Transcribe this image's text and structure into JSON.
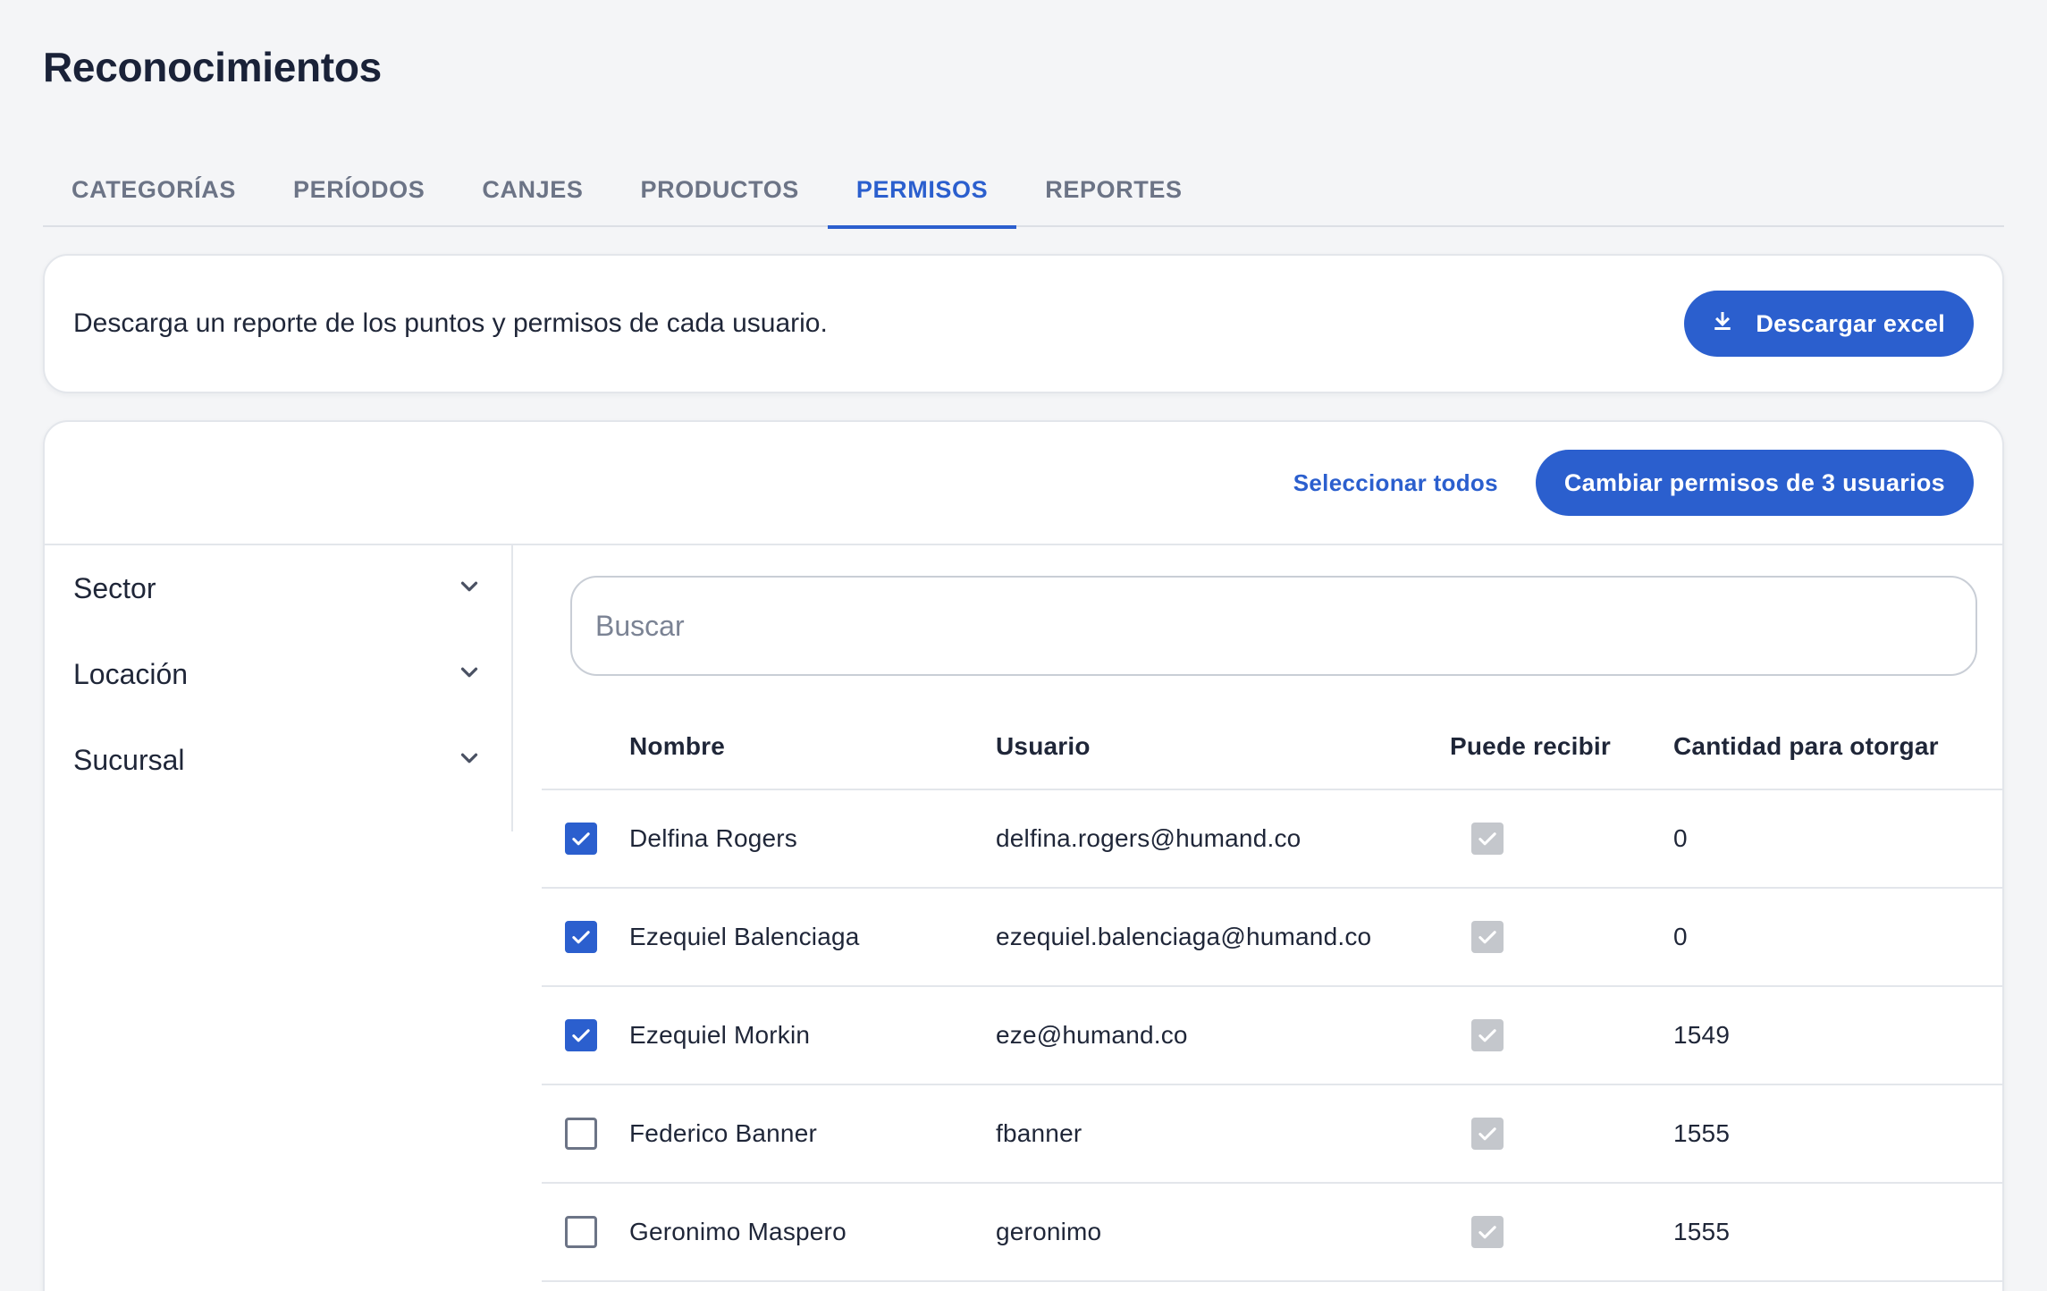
{
  "page": {
    "title": "Reconocimientos"
  },
  "tabs": [
    {
      "label": "CATEGORÍAS",
      "active": false
    },
    {
      "label": "PERÍODOS",
      "active": false
    },
    {
      "label": "CANJES",
      "active": false
    },
    {
      "label": "PRODUCTOS",
      "active": false
    },
    {
      "label": "PERMISOS",
      "active": true
    },
    {
      "label": "REPORTES",
      "active": false
    }
  ],
  "download": {
    "text": "Descarga un reporte de los puntos y permisos de cada usuario.",
    "button_label": "Descargar excel",
    "icon": "download-icon"
  },
  "toolbar": {
    "select_all_label": "Seleccionar todos",
    "change_button_label": "Cambiar permisos de 3 usuarios"
  },
  "filters": [
    {
      "label": "Sector",
      "icon": "chevron-down-icon"
    },
    {
      "label": "Locación",
      "icon": "chevron-down-icon"
    },
    {
      "label": "Sucursal",
      "icon": "chevron-down-icon"
    }
  ],
  "search": {
    "placeholder": "Buscar",
    "value": ""
  },
  "table": {
    "columns": [
      "Nombre",
      "Usuario",
      "Puede recibir",
      "Cantidad para otorgar"
    ],
    "rows": [
      {
        "selected": true,
        "name": "Delfina Rogers",
        "user": "delfina.rogers@humand.co",
        "can_receive": true,
        "quantity": "0"
      },
      {
        "selected": true,
        "name": "Ezequiel Balenciaga",
        "user": "ezequiel.balenciaga@humand.co",
        "can_receive": true,
        "quantity": "0"
      },
      {
        "selected": true,
        "name": "Ezequiel Morkin",
        "user": "eze@humand.co",
        "can_receive": true,
        "quantity": "1549"
      },
      {
        "selected": false,
        "name": "Federico Banner",
        "user": "fbanner",
        "can_receive": true,
        "quantity": "1555"
      },
      {
        "selected": false,
        "name": "Geronimo Maspero",
        "user": "geronimo",
        "can_receive": true,
        "quantity": "1555"
      }
    ]
  },
  "colors": {
    "accent": "#2b5fce",
    "background": "#f4f5f7",
    "disabled_checkbox": "#c4c7cc"
  }
}
